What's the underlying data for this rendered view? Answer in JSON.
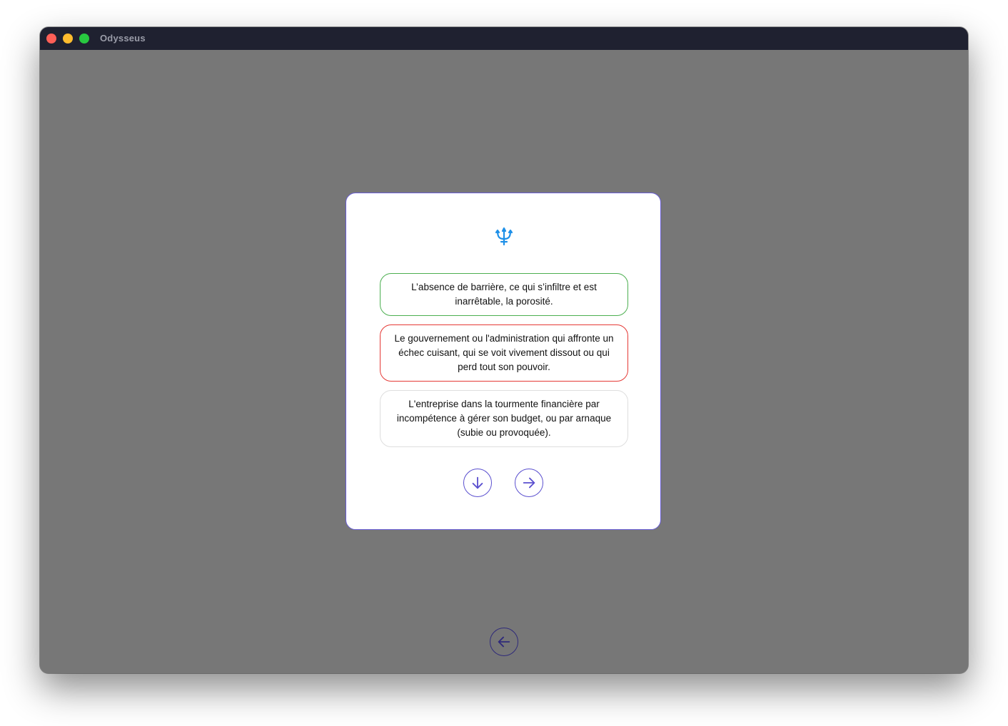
{
  "window": {
    "title": "Odysseus"
  },
  "card": {
    "icon": "trident-icon",
    "options": [
      {
        "text": "L’absence de barrière, ce qui s’infiltre et est inarrêtable, la porosité.",
        "state": "correct"
      },
      {
        "text": "Le gouvernement ou l'administration qui affronte un échec cuisant, qui se voit vivement dissout ou qui perd tout son pouvoir.",
        "state": "wrong"
      },
      {
        "text": "L'entreprise dans la tourmente financière par incompétence à gérer son budget, ou par arnaque (subie ou provoquée).",
        "state": "neutral"
      }
    ],
    "buttons": {
      "down_icon": "arrow-down-icon",
      "next_icon": "arrow-right-icon"
    }
  },
  "footer": {
    "back_icon": "arrow-left-icon"
  },
  "colors": {
    "accent": "#5a4fcf",
    "icon_blue": "#1e90e8",
    "correct": "#4caf50",
    "wrong": "#e53935",
    "neutral": "#dedede",
    "backdrop": "#777777",
    "titlebar": "#1f2130"
  }
}
